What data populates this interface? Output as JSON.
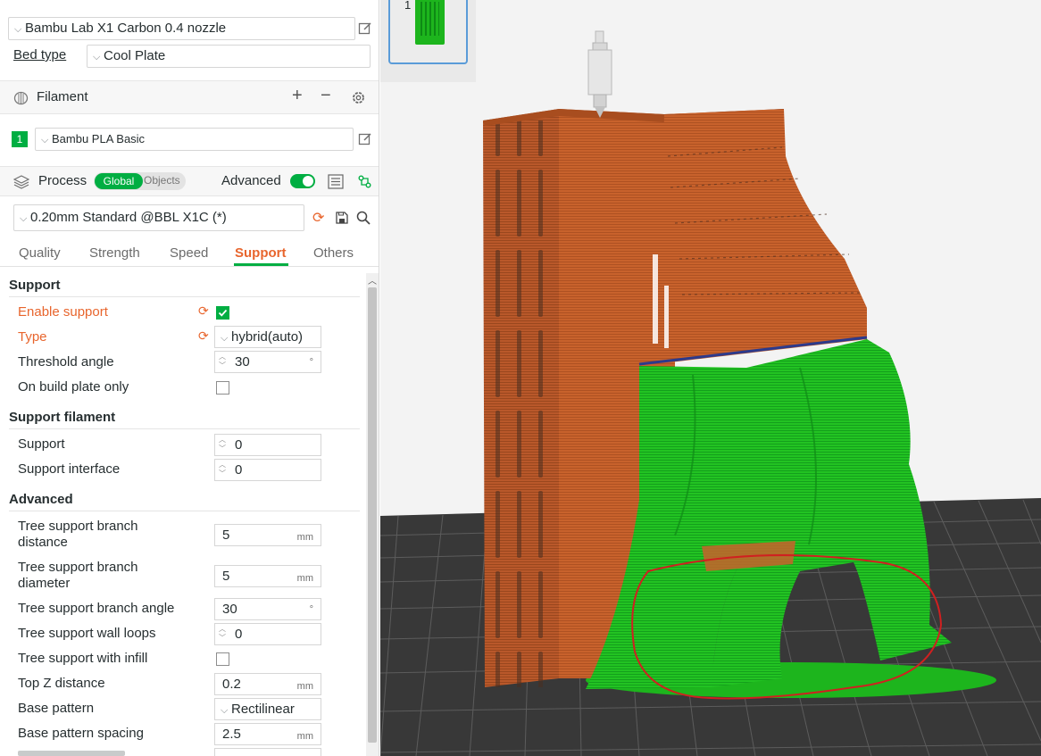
{
  "printer": {
    "name": "Bambu Lab X1 Carbon 0.4 nozzle"
  },
  "bed": {
    "label": "Bed type",
    "value": "Cool Plate"
  },
  "filament": {
    "title": "Filament",
    "slot_number": "1",
    "slot_color": "#00ae42",
    "value": "Bambu PLA Basic"
  },
  "process": {
    "title": "Process",
    "toggle_global": "Global",
    "toggle_objects": "Objects",
    "advanced_label": "Advanced",
    "preset": "0.20mm Standard @BBL X1C (*)"
  },
  "tabs": [
    "Quality",
    "Strength",
    "Speed",
    "Support",
    "Others"
  ],
  "active_tab": "Support",
  "groups": {
    "support": "Support",
    "support_filament": "Support filament",
    "advanced": "Advanced"
  },
  "settings": {
    "enable_support": {
      "label": "Enable support",
      "checked": true
    },
    "type": {
      "label": "Type",
      "value": "hybrid(auto)"
    },
    "threshold_angle": {
      "label": "Threshold angle",
      "value": "30",
      "unit": "°"
    },
    "on_build_plate_only": {
      "label": "On build plate only",
      "checked": false
    },
    "support": {
      "label": "Support",
      "value": "0"
    },
    "support_interface": {
      "label": "Support interface",
      "value": "0"
    },
    "branch_distance": {
      "label": "Tree support branch distance",
      "value": "5",
      "unit": "mm"
    },
    "branch_diameter": {
      "label": "Tree support branch diameter",
      "value": "5",
      "unit": "mm"
    },
    "branch_angle": {
      "label": "Tree support branch angle",
      "value": "30",
      "unit": "°"
    },
    "wall_loops": {
      "label": "Tree support wall loops",
      "value": "0"
    },
    "with_infill": {
      "label": "Tree support with infill",
      "checked": false
    },
    "top_z_distance": {
      "label": "Top Z distance",
      "value": "0.2",
      "unit": "mm"
    },
    "base_pattern": {
      "label": "Base pattern",
      "value": "Rectilinear"
    },
    "base_pattern_spacing": {
      "label": "Base pattern spacing",
      "value": "2.5",
      "unit": "mm"
    }
  },
  "plate": {
    "number": "1"
  },
  "colors": {
    "accent": "#00ae42",
    "modified": "#e8652d",
    "model": "#c8622c",
    "support": "#1fbf1f",
    "annotation": "#d02020"
  }
}
